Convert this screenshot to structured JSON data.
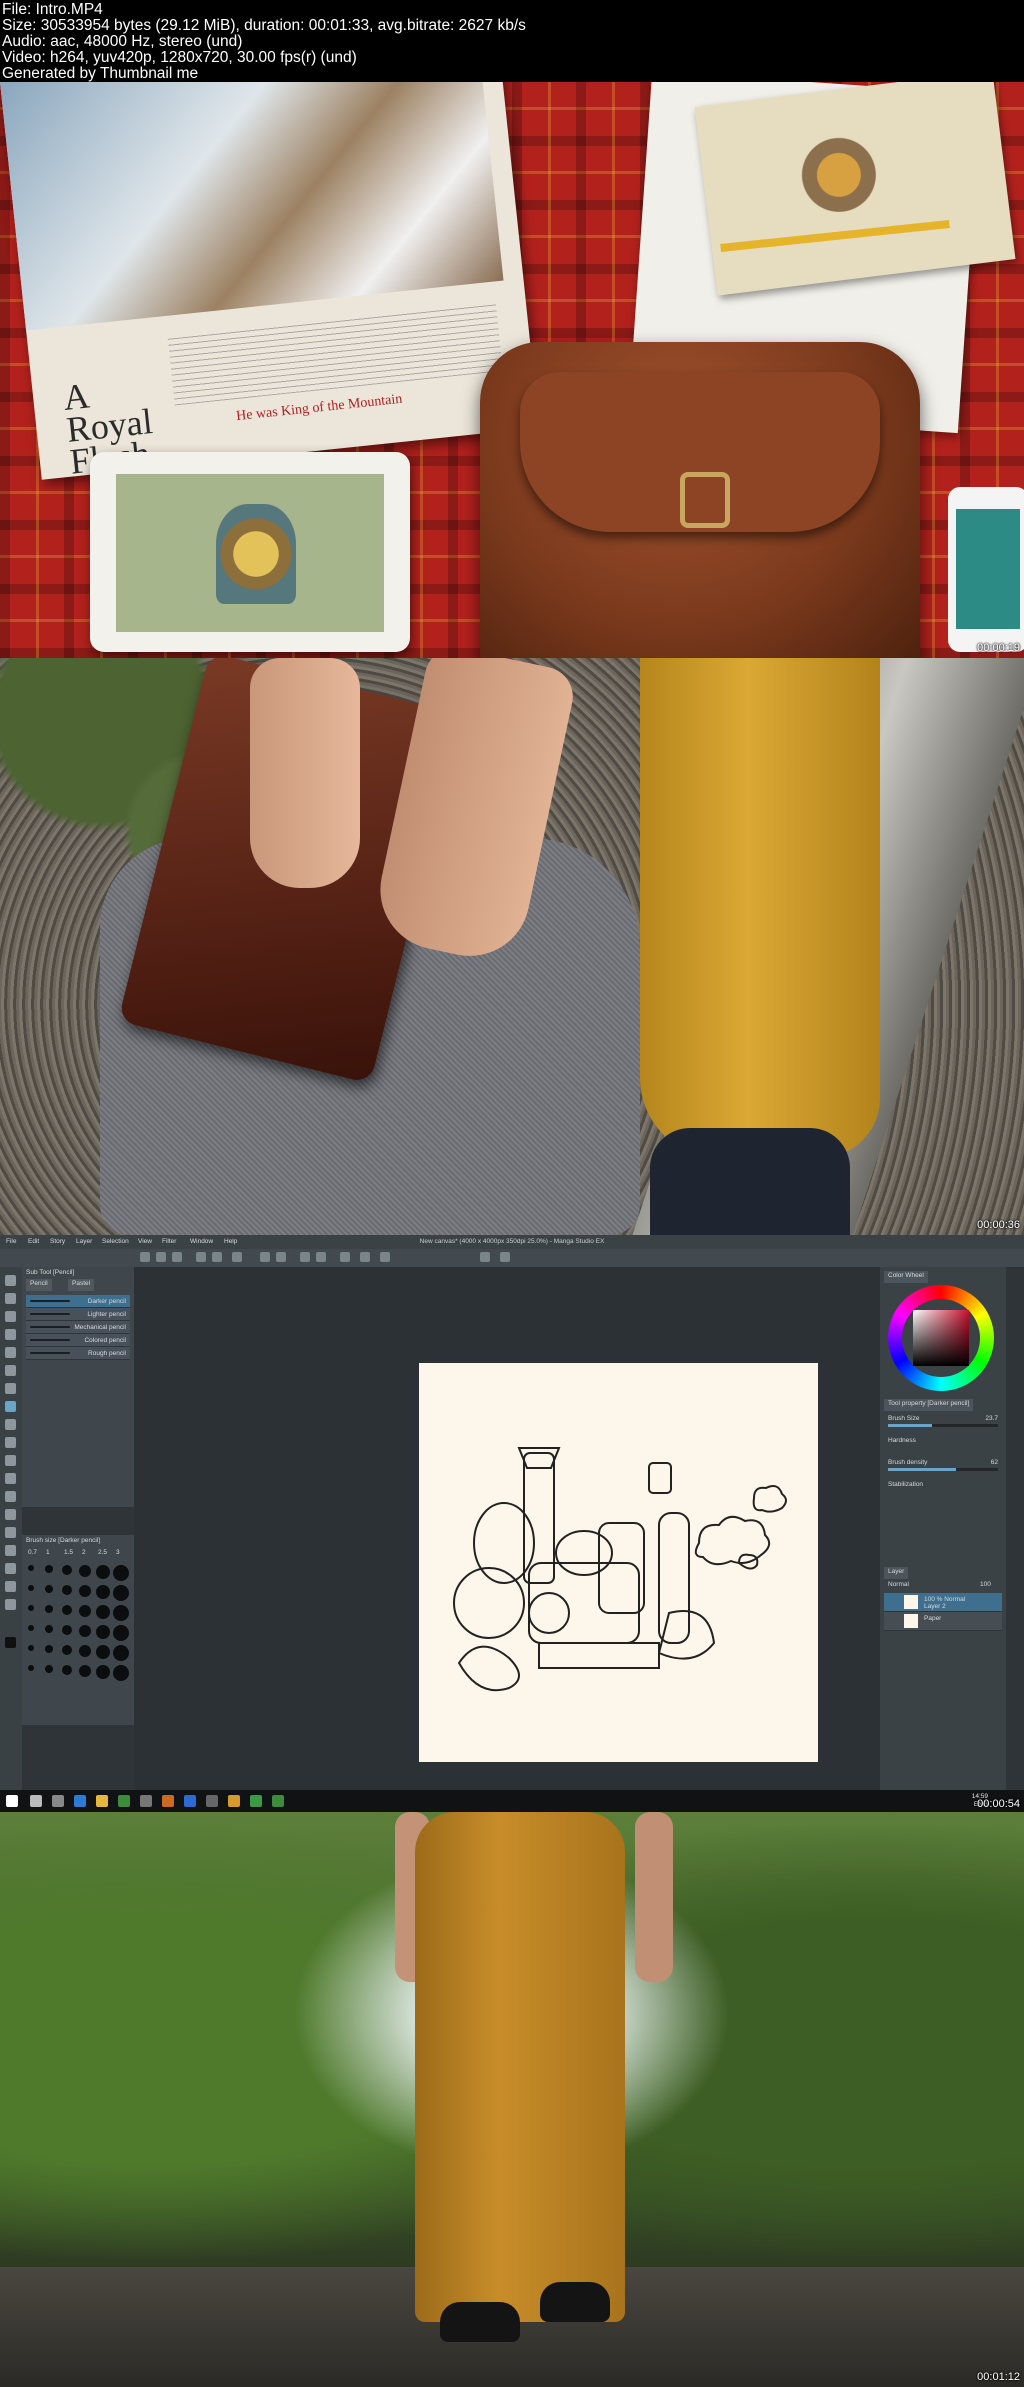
{
  "header": {
    "file": "File: Intro.MP4",
    "size": "Size: 30533954 bytes (29.12 MiB), duration: 00:01:33, avg.bitrate: 2627 kb/s",
    "audio": "Audio: aac, 48000 Hz, stereo (und)",
    "video": "Video: h264, yuv420p, 1280x720, 30.00 fps(r) (und)",
    "generator": "Generated by Thumbnail me"
  },
  "frames": [
    {
      "timestamp": "00:00:19",
      "magazine_title": "A Royal Flush",
      "magazine_subtitle": "He was King of the Mountain"
    },
    {
      "timestamp": "00:00:36"
    },
    {
      "timestamp": "00:00:54"
    },
    {
      "timestamp": "00:01:12"
    }
  ],
  "app": {
    "window_title": "New canvas* (4000 x 4000px 350dpi 25.0%) - Manga Studio EX",
    "menu": [
      "File",
      "Edit",
      "Story",
      "Layer",
      "Selection",
      "View",
      "Filter",
      "Window",
      "Help"
    ],
    "subtool_title": "Sub Tool [Pencil]",
    "subtool_tabs": [
      "Pencil",
      "Pastel"
    ],
    "subtools": [
      "Darker pencil",
      "Lighter pencil",
      "Mechanical pencil",
      "Colored pencil",
      "Rough pencil"
    ],
    "brush_size_title": "Brush size [Darker pencil]",
    "brush_sizes": [
      "0.7",
      "1",
      "1.5",
      "2",
      "2.5",
      "3"
    ],
    "color_wheel_tab": "Color Wheel",
    "tool_property_tab": "Tool property [Darker pencil]",
    "brush_size_label": "Brush Size",
    "brush_size_value": "23.7",
    "hardness_label": "Hardness",
    "brush_density_label": "Brush density",
    "brush_density_value": "62",
    "stabilization_label": "Stabilization",
    "layer_tab": "Layer",
    "blend_mode": "Normal",
    "opacity_value": "100",
    "layers": [
      {
        "name_line1": "100 % Normal",
        "name_line2": "Layer 2"
      },
      {
        "name_line1": "Paper",
        "name_line2": ""
      }
    ],
    "clock_time": "14:59",
    "clock_lang": "ENG"
  }
}
